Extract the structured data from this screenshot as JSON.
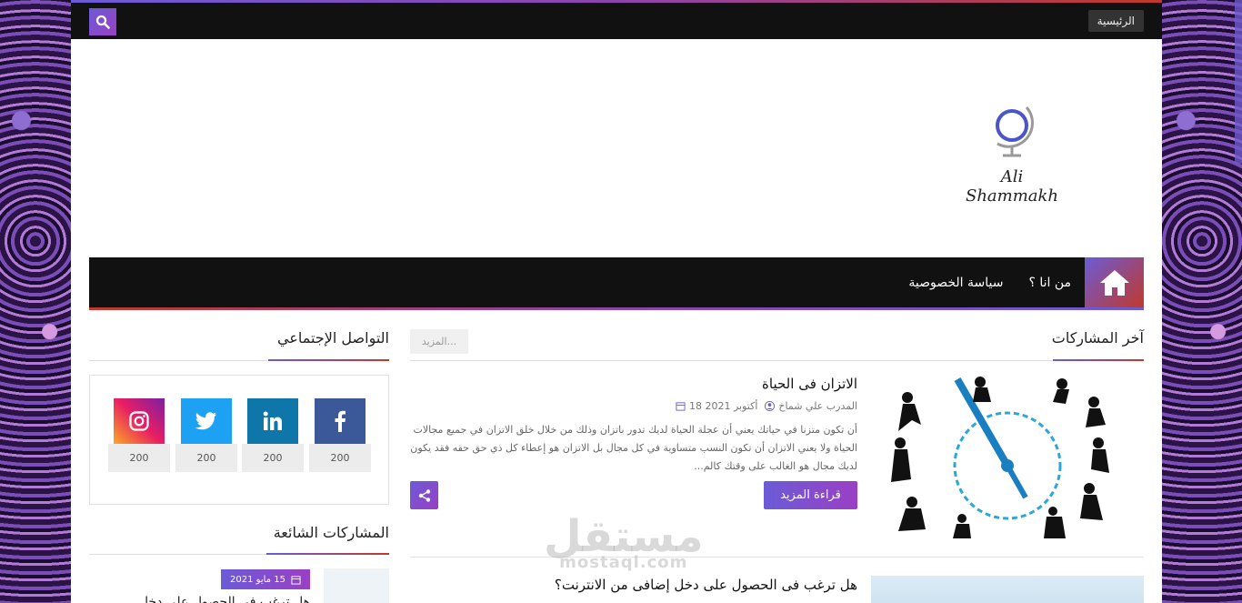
{
  "topbar": {
    "home_label": "الرئيسية"
  },
  "header": {
    "logo_text": "Ali Shammakh"
  },
  "nav": {
    "items": [
      "من انا ؟",
      "سياسة الخصوصية"
    ]
  },
  "latest": {
    "title": "آخر المشاركات",
    "more_label": "المزيد...",
    "posts": [
      {
        "title": "الاتزان فى الحياة",
        "author": "المدرب علي شماخ",
        "date": "18 أكتوبر 2021",
        "excerpt": "أن تكون متزنا في حياتك يعني أن عجلة الحياة لديك تدور باتزان  وذلك من خلال خلق الاتزان في جميع مجالات الحياة ولا يعني الاتزان أن تكون النسب متساوية في كل مجال   بل الاتزان هو إعطاء كل ذي حق حقه     فقد يكون لديك مجال هو الغالب على وقتك كالم...",
        "read_more": "قراءة المزيد"
      },
      {
        "title": "هل ترغب فى الحصول على دخل إضافى من الانترنت؟"
      }
    ]
  },
  "social": {
    "title": "التواصل الإجتماعي",
    "items": [
      {
        "icon": "facebook-icon",
        "count": "200",
        "color": "#3b5998"
      },
      {
        "icon": "linkedin-icon",
        "count": "200",
        "color": "#0e76a8"
      },
      {
        "icon": "twitter-icon",
        "count": "200",
        "color": "#1da1f2"
      },
      {
        "icon": "instagram-icon",
        "count": "200",
        "color": "#e91e63"
      }
    ]
  },
  "popular": {
    "title": "المشاركات الشائعة",
    "date": "15 مايو 2021",
    "post_title": "هل ترغب فى الحصول على دخل"
  },
  "watermark": {
    "arabic": "مستقل",
    "latin": "mostaql.com"
  },
  "colors": {
    "accent": "#6b5bd6",
    "accent2": "#9b3fc5",
    "dark": "#111111"
  }
}
